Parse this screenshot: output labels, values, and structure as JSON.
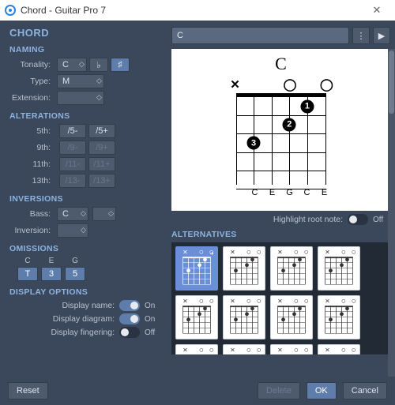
{
  "window": {
    "title": "Chord - Guitar Pro 7"
  },
  "header": "CHORD",
  "search": {
    "value": "C"
  },
  "naming": {
    "heading": "NAMING",
    "tonality_label": "Tonality:",
    "tonality": "C",
    "flat": "♭",
    "sharp": "♯",
    "type_label": "Type:",
    "type": "M",
    "ext_label": "Extension:",
    "ext": ""
  },
  "alterations": {
    "heading": "ALTERATIONS",
    "rows": [
      {
        "label": "5th:",
        "a": "/5-",
        "b": "/5+",
        "enabled": true
      },
      {
        "label": "9th:",
        "a": "/9-",
        "b": "/9+",
        "enabled": false
      },
      {
        "label": "11th:",
        "a": "/11-",
        "b": "/11+",
        "enabled": false
      },
      {
        "label": "13th:",
        "a": "/13-",
        "b": "/13+",
        "enabled": false
      }
    ]
  },
  "inversions": {
    "heading": "INVERSIONS",
    "bass_label": "Bass:",
    "bass": "C",
    "inv_label": "Inversion:",
    "inv": ""
  },
  "omissions": {
    "heading": "OMISSIONS",
    "items": [
      {
        "note": "C",
        "deg": "T"
      },
      {
        "note": "E",
        "deg": "3"
      },
      {
        "note": "G",
        "deg": "5"
      }
    ]
  },
  "display": {
    "heading": "DISPLAY OPTIONS",
    "name_label": "Display name:",
    "name_on": true,
    "diagram_label": "Display diagram:",
    "diagram_on": true,
    "fingering_label": "Display fingering:",
    "fingering_on": false,
    "on_text": "On",
    "off_text": "Off"
  },
  "diagram": {
    "name": "C",
    "markers": [
      "✕",
      "",
      "",
      "◯",
      "",
      "◯"
    ],
    "fingers": [
      {
        "string": 5,
        "fret": 1,
        "num": "1"
      },
      {
        "string": 4,
        "fret": 2,
        "num": "2"
      },
      {
        "string": 2,
        "fret": 3,
        "num": "3"
      }
    ],
    "notes": [
      "",
      "C",
      "E",
      "G",
      "C",
      "E"
    ]
  },
  "highlight": {
    "label": "Highlight root note:",
    "on": false
  },
  "alternatives_heading": "ALTERNATIVES",
  "footer": {
    "reset": "Reset",
    "delete": "Delete",
    "ok": "OK",
    "cancel": "Cancel"
  }
}
